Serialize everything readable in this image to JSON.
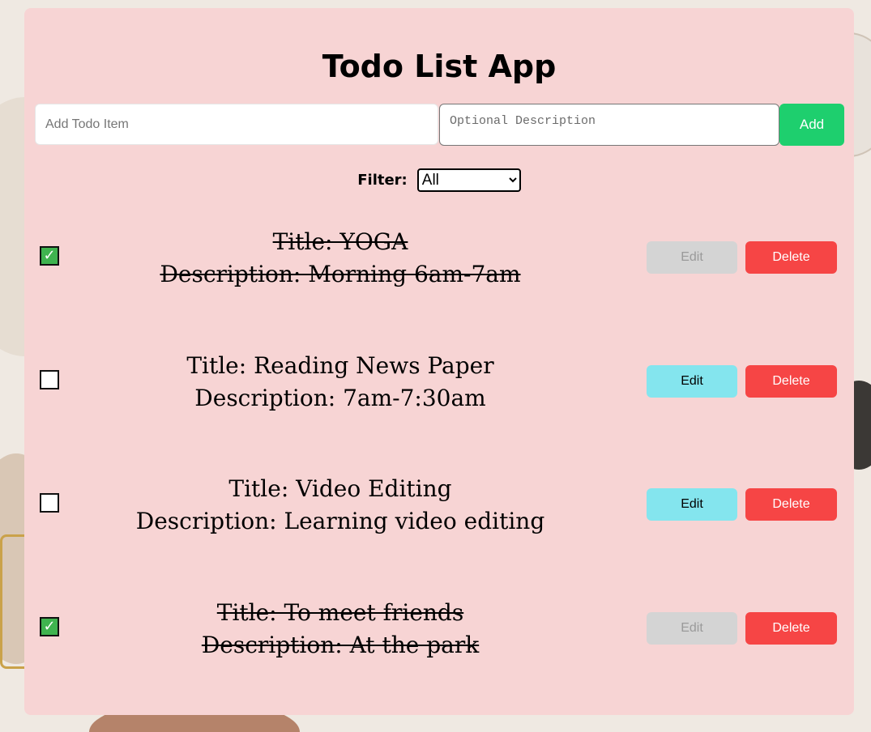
{
  "app": {
    "title": "Todo List App"
  },
  "form": {
    "todo_placeholder": "Add Todo Item",
    "desc_placeholder": "Optional Description",
    "add_label": "Add"
  },
  "filter": {
    "label": "Filter:",
    "options": [
      "All"
    ],
    "selected": "All"
  },
  "todos": [
    {
      "title": "Title: YOGA",
      "description": "Description: Morning 6am-7am",
      "completed": true,
      "edit_label": "Edit",
      "delete_label": "Delete"
    },
    {
      "title": "Title: Reading News Paper",
      "description": "Description: 7am-7:30am",
      "completed": false,
      "edit_label": "Edit",
      "delete_label": "Delete"
    },
    {
      "title": "Title: Video Editing",
      "description": "Description: Learning video editing",
      "completed": false,
      "edit_label": "Edit",
      "delete_label": "Delete"
    },
    {
      "title": "Title: To meet friends",
      "description": "Description: At the park",
      "completed": true,
      "edit_label": "Edit",
      "delete_label": "Delete"
    }
  ],
  "colors": {
    "card": "#f7d4d4",
    "add_button": "#1ecf6e",
    "edit_button": "#84e5ee",
    "edit_button_disabled": "#d4d4d4",
    "delete_button": "#f64545",
    "checkbox_checked": "#3fb34f"
  },
  "icons": {
    "check": "check-mark-icon"
  }
}
